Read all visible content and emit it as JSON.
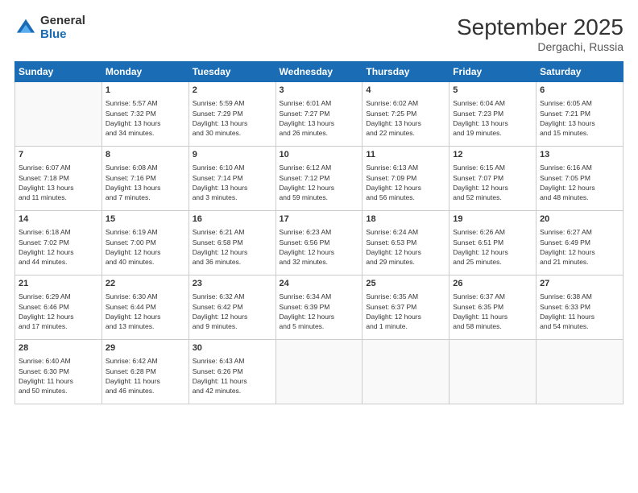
{
  "logo": {
    "general": "General",
    "blue": "Blue"
  },
  "title": "September 2025",
  "location": "Dergachi, Russia",
  "days_of_week": [
    "Sunday",
    "Monday",
    "Tuesday",
    "Wednesday",
    "Thursday",
    "Friday",
    "Saturday"
  ],
  "weeks": [
    [
      {
        "day": "",
        "info": ""
      },
      {
        "day": "1",
        "info": "Sunrise: 5:57 AM\nSunset: 7:32 PM\nDaylight: 13 hours\nand 34 minutes."
      },
      {
        "day": "2",
        "info": "Sunrise: 5:59 AM\nSunset: 7:29 PM\nDaylight: 13 hours\nand 30 minutes."
      },
      {
        "day": "3",
        "info": "Sunrise: 6:01 AM\nSunset: 7:27 PM\nDaylight: 13 hours\nand 26 minutes."
      },
      {
        "day": "4",
        "info": "Sunrise: 6:02 AM\nSunset: 7:25 PM\nDaylight: 13 hours\nand 22 minutes."
      },
      {
        "day": "5",
        "info": "Sunrise: 6:04 AM\nSunset: 7:23 PM\nDaylight: 13 hours\nand 19 minutes."
      },
      {
        "day": "6",
        "info": "Sunrise: 6:05 AM\nSunset: 7:21 PM\nDaylight: 13 hours\nand 15 minutes."
      }
    ],
    [
      {
        "day": "7",
        "info": "Sunrise: 6:07 AM\nSunset: 7:18 PM\nDaylight: 13 hours\nand 11 minutes."
      },
      {
        "day": "8",
        "info": "Sunrise: 6:08 AM\nSunset: 7:16 PM\nDaylight: 13 hours\nand 7 minutes."
      },
      {
        "day": "9",
        "info": "Sunrise: 6:10 AM\nSunset: 7:14 PM\nDaylight: 13 hours\nand 3 minutes."
      },
      {
        "day": "10",
        "info": "Sunrise: 6:12 AM\nSunset: 7:12 PM\nDaylight: 12 hours\nand 59 minutes."
      },
      {
        "day": "11",
        "info": "Sunrise: 6:13 AM\nSunset: 7:09 PM\nDaylight: 12 hours\nand 56 minutes."
      },
      {
        "day": "12",
        "info": "Sunrise: 6:15 AM\nSunset: 7:07 PM\nDaylight: 12 hours\nand 52 minutes."
      },
      {
        "day": "13",
        "info": "Sunrise: 6:16 AM\nSunset: 7:05 PM\nDaylight: 12 hours\nand 48 minutes."
      }
    ],
    [
      {
        "day": "14",
        "info": "Sunrise: 6:18 AM\nSunset: 7:02 PM\nDaylight: 12 hours\nand 44 minutes."
      },
      {
        "day": "15",
        "info": "Sunrise: 6:19 AM\nSunset: 7:00 PM\nDaylight: 12 hours\nand 40 minutes."
      },
      {
        "day": "16",
        "info": "Sunrise: 6:21 AM\nSunset: 6:58 PM\nDaylight: 12 hours\nand 36 minutes."
      },
      {
        "day": "17",
        "info": "Sunrise: 6:23 AM\nSunset: 6:56 PM\nDaylight: 12 hours\nand 32 minutes."
      },
      {
        "day": "18",
        "info": "Sunrise: 6:24 AM\nSunset: 6:53 PM\nDaylight: 12 hours\nand 29 minutes."
      },
      {
        "day": "19",
        "info": "Sunrise: 6:26 AM\nSunset: 6:51 PM\nDaylight: 12 hours\nand 25 minutes."
      },
      {
        "day": "20",
        "info": "Sunrise: 6:27 AM\nSunset: 6:49 PM\nDaylight: 12 hours\nand 21 minutes."
      }
    ],
    [
      {
        "day": "21",
        "info": "Sunrise: 6:29 AM\nSunset: 6:46 PM\nDaylight: 12 hours\nand 17 minutes."
      },
      {
        "day": "22",
        "info": "Sunrise: 6:30 AM\nSunset: 6:44 PM\nDaylight: 12 hours\nand 13 minutes."
      },
      {
        "day": "23",
        "info": "Sunrise: 6:32 AM\nSunset: 6:42 PM\nDaylight: 12 hours\nand 9 minutes."
      },
      {
        "day": "24",
        "info": "Sunrise: 6:34 AM\nSunset: 6:39 PM\nDaylight: 12 hours\nand 5 minutes."
      },
      {
        "day": "25",
        "info": "Sunrise: 6:35 AM\nSunset: 6:37 PM\nDaylight: 12 hours\nand 1 minute."
      },
      {
        "day": "26",
        "info": "Sunrise: 6:37 AM\nSunset: 6:35 PM\nDaylight: 11 hours\nand 58 minutes."
      },
      {
        "day": "27",
        "info": "Sunrise: 6:38 AM\nSunset: 6:33 PM\nDaylight: 11 hours\nand 54 minutes."
      }
    ],
    [
      {
        "day": "28",
        "info": "Sunrise: 6:40 AM\nSunset: 6:30 PM\nDaylight: 11 hours\nand 50 minutes."
      },
      {
        "day": "29",
        "info": "Sunrise: 6:42 AM\nSunset: 6:28 PM\nDaylight: 11 hours\nand 46 minutes."
      },
      {
        "day": "30",
        "info": "Sunrise: 6:43 AM\nSunset: 6:26 PM\nDaylight: 11 hours\nand 42 minutes."
      },
      {
        "day": "",
        "info": ""
      },
      {
        "day": "",
        "info": ""
      },
      {
        "day": "",
        "info": ""
      },
      {
        "day": "",
        "info": ""
      }
    ]
  ]
}
